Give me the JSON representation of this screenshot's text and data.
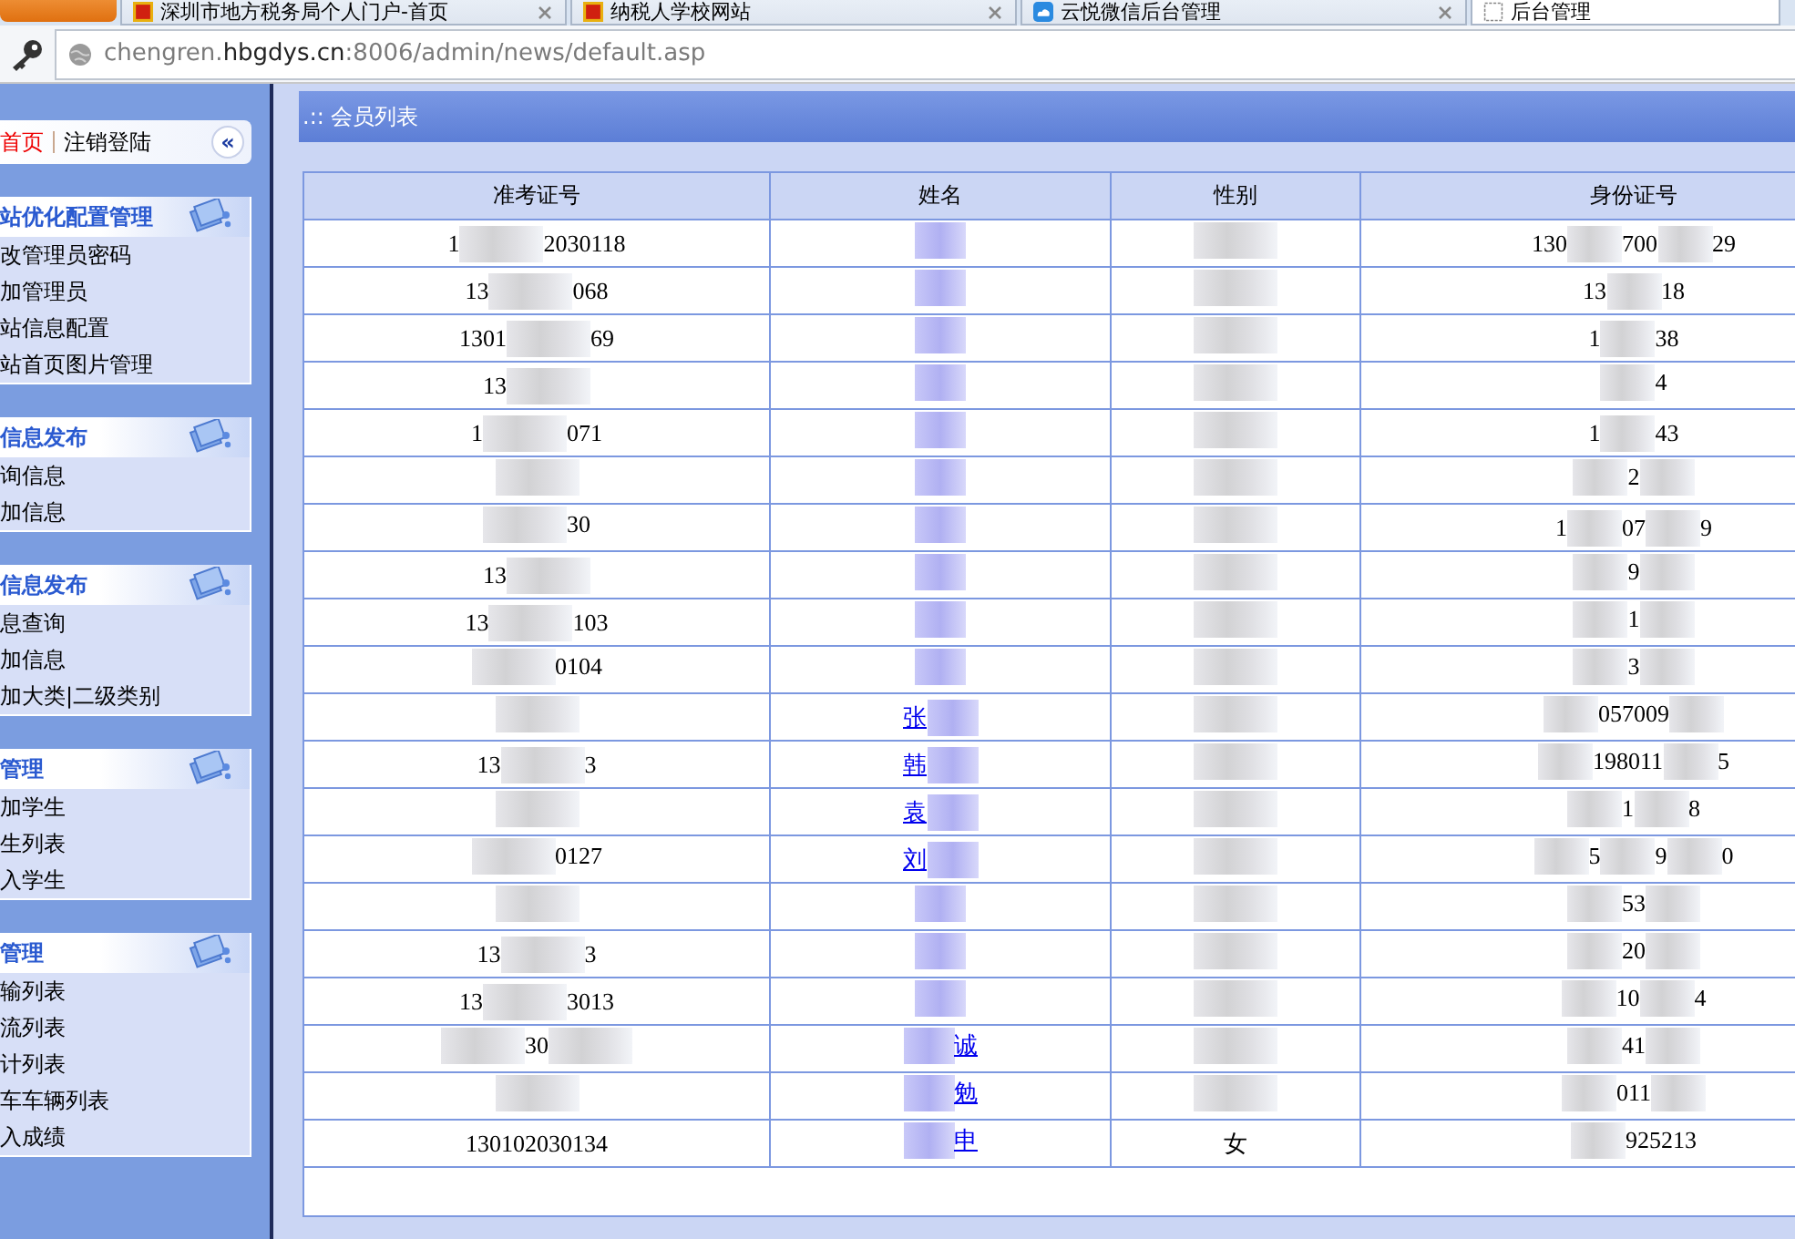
{
  "browser": {
    "tabs": [
      {
        "title": "深圳市地方税务局个人门户-首页",
        "selected": false
      },
      {
        "title": "纳税人学校网站",
        "selected": false
      },
      {
        "title": "云悦微信后台管理",
        "selected": false
      },
      {
        "title": "后台管理",
        "selected": true
      }
    ],
    "address": "chengren.**hbgdys.cn**:8006/admin/news/default.asp"
  },
  "sidebar": {
    "home": "首页",
    "logout": "注销登陆",
    "collapse": "«",
    "sections": [
      {
        "title": "站优化配置管理",
        "items": [
          "改管理员密码",
          "加管理员",
          "站信息配置",
          "站首页图片管理"
        ]
      },
      {
        "title": "信息发布",
        "items": [
          "询信息",
          "加信息"
        ]
      },
      {
        "title": "信息发布",
        "items": [
          "息查询",
          "加信息",
          "加大类|二级类别"
        ]
      },
      {
        "title": "管理",
        "items": [
          "加学生",
          "生列表",
          "入学生"
        ]
      },
      {
        "title": "管理",
        "items": [
          "输列表",
          "流列表",
          "计列表",
          "车车辆列表",
          "入成绩"
        ]
      }
    ]
  },
  "panel": {
    "title": ".:: 会员列表"
  },
  "table": {
    "columns": [
      "准考证号",
      "姓名",
      "性别",
      "身份证号"
    ],
    "rows": [
      [
        {
          "parts": [
            "1",
            "2030118"
          ]
        },
        {
          "redacted": true
        },
        {
          "redacted": true
        },
        {
          "parts": [
            "130",
            "700",
            "29"
          ]
        }
      ],
      [
        {
          "parts": [
            "13",
            "068"
          ]
        },
        {
          "redacted": true
        },
        {
          "redacted": true
        },
        {
          "parts": [
            "13",
            "18"
          ]
        }
      ],
      [
        {
          "parts": [
            "1301",
            "69"
          ]
        },
        {
          "redacted": true
        },
        {
          "redacted": true
        },
        {
          "parts": [
            "1",
            "38"
          ]
        }
      ],
      [
        {
          "parts": [
            "13"
          ],
          "ends_redacted": true
        },
        {
          "redacted": true
        },
        {
          "redacted": true
        },
        {
          "parts": [
            "4"
          ],
          "starts_redacted": true
        }
      ],
      [
        {
          "parts": [
            "1",
            "071"
          ]
        },
        {
          "redacted": true
        },
        {
          "redacted": true
        },
        {
          "parts": [
            "1",
            "43"
          ]
        }
      ],
      [
        {
          "redacted": true
        },
        {
          "redacted": true
        },
        {
          "redacted": true
        },
        {
          "parts": [
            "2"
          ],
          "starts_redacted": true,
          "ends_redacted": true
        }
      ],
      [
        {
          "parts": [
            "30"
          ],
          "starts_redacted": true
        },
        {
          "redacted": true
        },
        {
          "redacted": true
        },
        {
          "parts": [
            "1",
            "07",
            "9"
          ]
        }
      ],
      [
        {
          "parts": [
            "13"
          ],
          "ends_redacted": true
        },
        {
          "redacted": true
        },
        {
          "redacted": true
        },
        {
          "parts": [
            "9"
          ],
          "starts_redacted": true,
          "ends_redacted": true
        }
      ],
      [
        {
          "parts": [
            "13",
            "103"
          ]
        },
        {
          "redacted": true
        },
        {
          "redacted": true
        },
        {
          "parts": [
            "1"
          ],
          "starts_redacted": true,
          "ends_redacted": true
        }
      ],
      [
        {
          "parts": [
            "0104"
          ],
          "starts_redacted": true
        },
        {
          "redacted": true
        },
        {
          "redacted": true
        },
        {
          "parts": [
            "3"
          ],
          "starts_redacted": true,
          "ends_redacted": true
        }
      ],
      [
        {
          "redacted": true
        },
        {
          "parts": [
            "张"
          ],
          "ends_redacted": true
        },
        {
          "redacted": true
        },
        {
          "parts": [
            "057009"
          ],
          "starts_redacted": true,
          "ends_redacted": true
        }
      ],
      [
        {
          "parts": [
            "13",
            "3"
          ]
        },
        {
          "parts": [
            "韩"
          ],
          "ends_redacted": true
        },
        {
          "redacted": true
        },
        {
          "parts": [
            "198011",
            "5"
          ],
          "starts_redacted": true
        }
      ],
      [
        {
          "redacted": true
        },
        {
          "parts": [
            "袁"
          ],
          "ends_redacted": true
        },
        {
          "redacted": true
        },
        {
          "parts": [
            "1",
            "8"
          ],
          "starts_redacted": true
        }
      ],
      [
        {
          "parts": [
            "0127"
          ],
          "starts_redacted": true
        },
        {
          "parts": [
            "刘"
          ],
          "ends_redacted": true
        },
        {
          "redacted": true
        },
        {
          "parts": [
            "5",
            "9",
            "0"
          ],
          "starts_redacted": true
        }
      ],
      [
        {
          "redacted": true
        },
        {
          "redacted": true
        },
        {
          "redacted": true
        },
        {
          "parts": [
            "53"
          ],
          "starts_redacted": true,
          "ends_redacted": true
        }
      ],
      [
        {
          "parts": [
            "13",
            "3"
          ]
        },
        {
          "redacted": true
        },
        {
          "redacted": true
        },
        {
          "parts": [
            "20"
          ],
          "starts_redacted": true,
          "ends_redacted": true
        }
      ],
      [
        {
          "parts": [
            "13",
            "3013"
          ]
        },
        {
          "redacted": true
        },
        {
          "redacted": true
        },
        {
          "parts": [
            "10",
            "4"
          ],
          "starts_redacted": true
        }
      ],
      [
        {
          "parts": [
            "30"
          ],
          "starts_redacted": true,
          "ends_redacted": true
        },
        {
          "parts": [
            "诚"
          ],
          "starts_redacted": true
        },
        {
          "redacted": true
        },
        {
          "parts": [
            "41"
          ],
          "starts_redacted": true,
          "ends_redacted": true
        }
      ],
      [
        {
          "redacted": true
        },
        {
          "parts": [
            "勉"
          ],
          "starts_redacted": true
        },
        {
          "redacted": true
        },
        {
          "parts": [
            "011"
          ],
          "starts_redacted": true,
          "ends_redacted": true
        }
      ],
      [
        {
          "parts": [
            "130102030134"
          ]
        },
        {
          "parts": [
            "申"
          ],
          "starts_redacted": true
        },
        {
          "parts": [
            "女"
          ]
        },
        {
          "parts": [
            "925213"
          ],
          "starts_redacted": true
        }
      ]
    ]
  }
}
